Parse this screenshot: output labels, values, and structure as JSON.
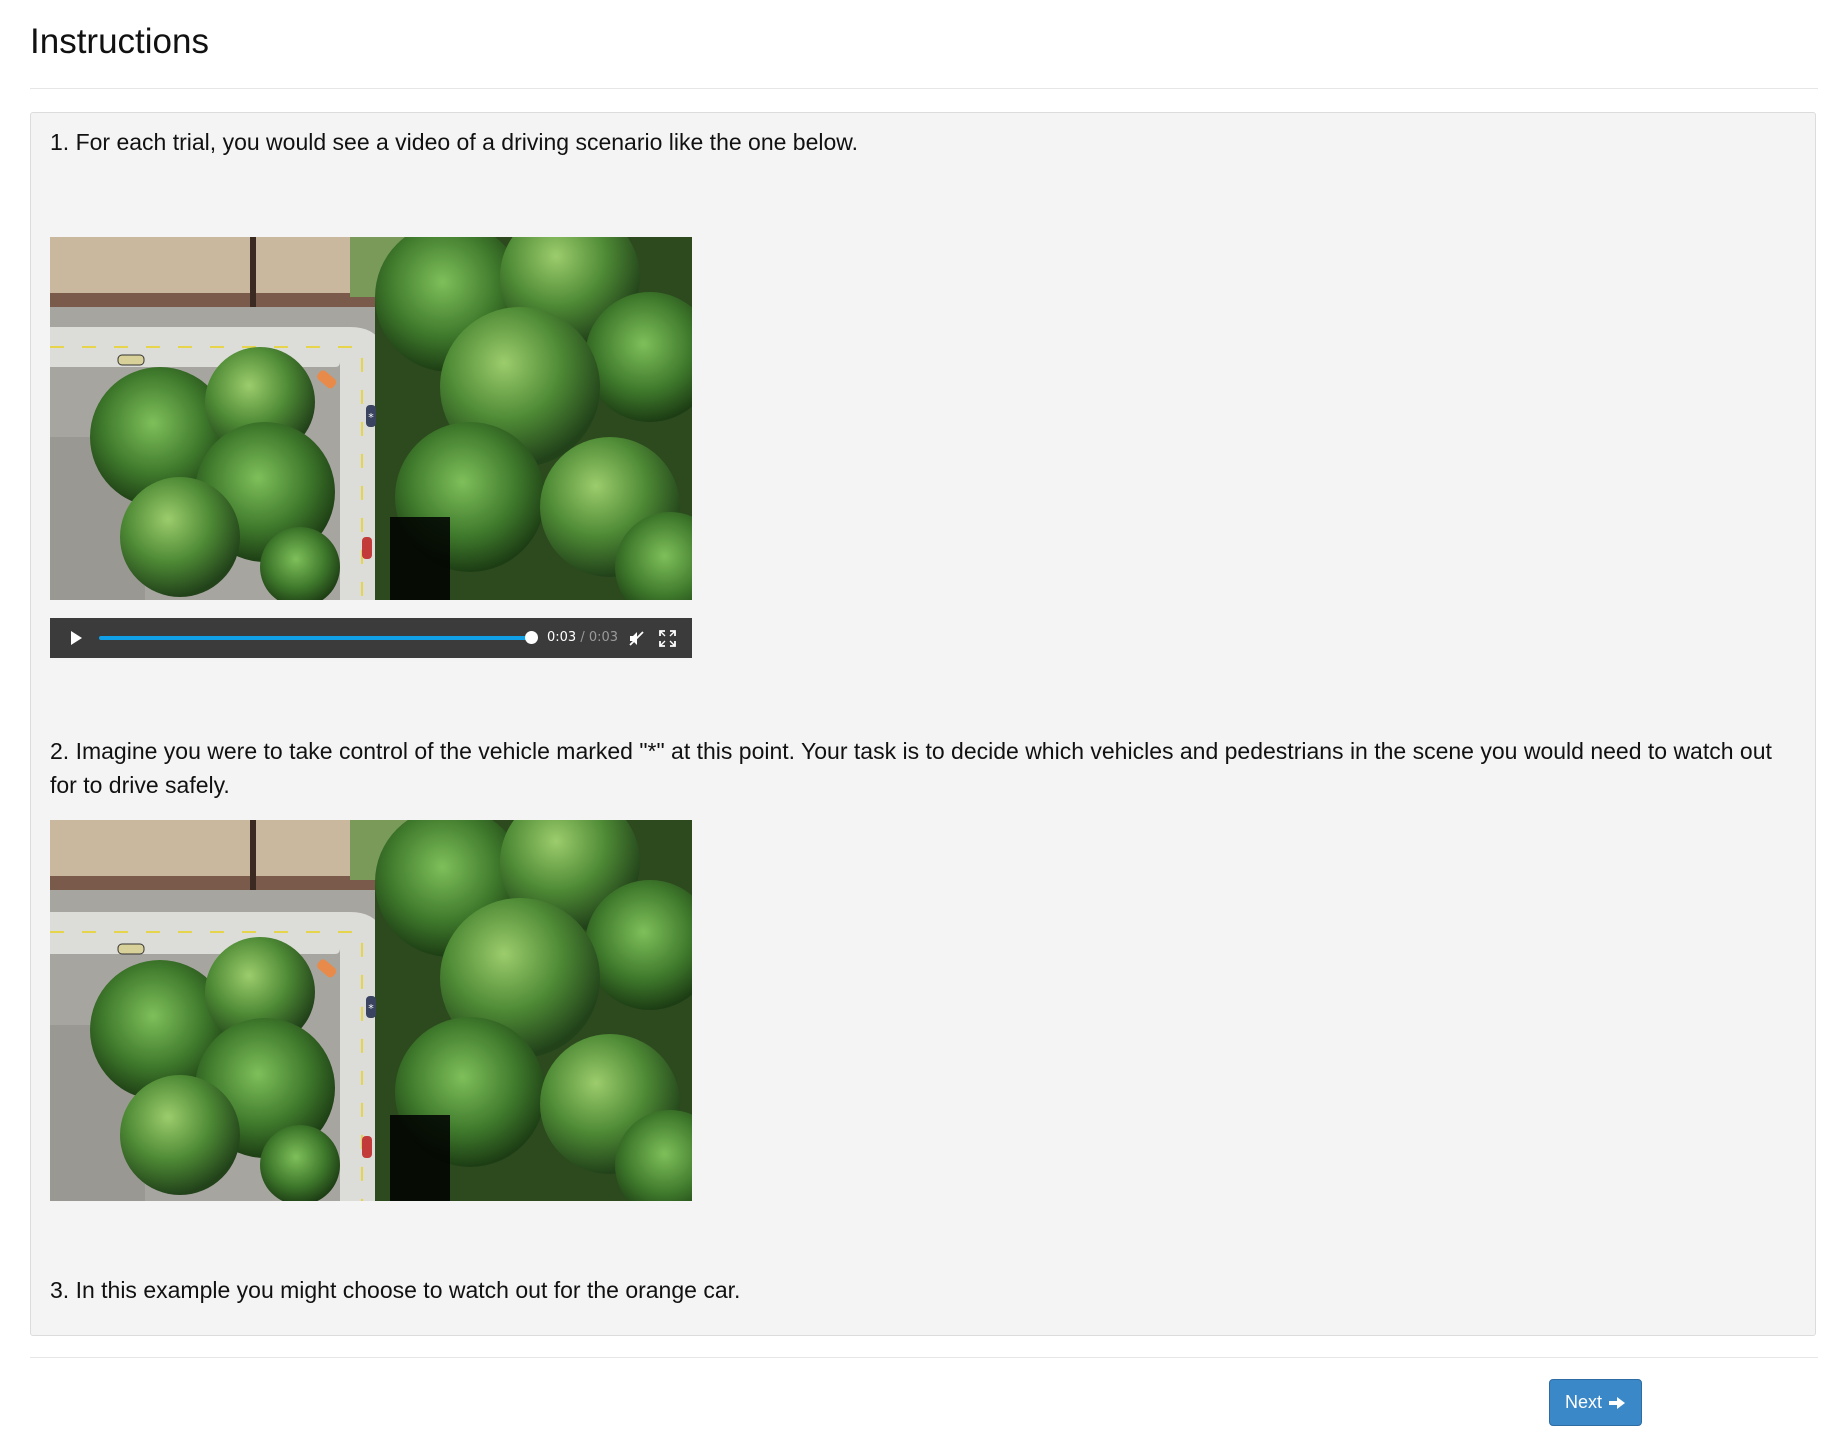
{
  "page": {
    "title": "Instructions"
  },
  "instructions": {
    "step1": "1. For each trial, you would see a video of a driving scenario like the one below.",
    "step2": "2. Imagine you were to take control of the vehicle marked \"*\" at this point. Your task is to decide which vehicles and pedestrians in the scene you would need to watch out for to drive safely.",
    "step3": "3. In this example you might choose to watch out for the orange car."
  },
  "video": {
    "current_time": "0:03",
    "separator": " / ",
    "duration": "0:03",
    "progress": 1.0,
    "muted": true,
    "accent_color": "#0fa0e8"
  },
  "scene_marker": "*",
  "navigation": {
    "next_label": "Next",
    "next_color": "#3a88c8",
    "next_icon": "arrow-right-icon"
  }
}
